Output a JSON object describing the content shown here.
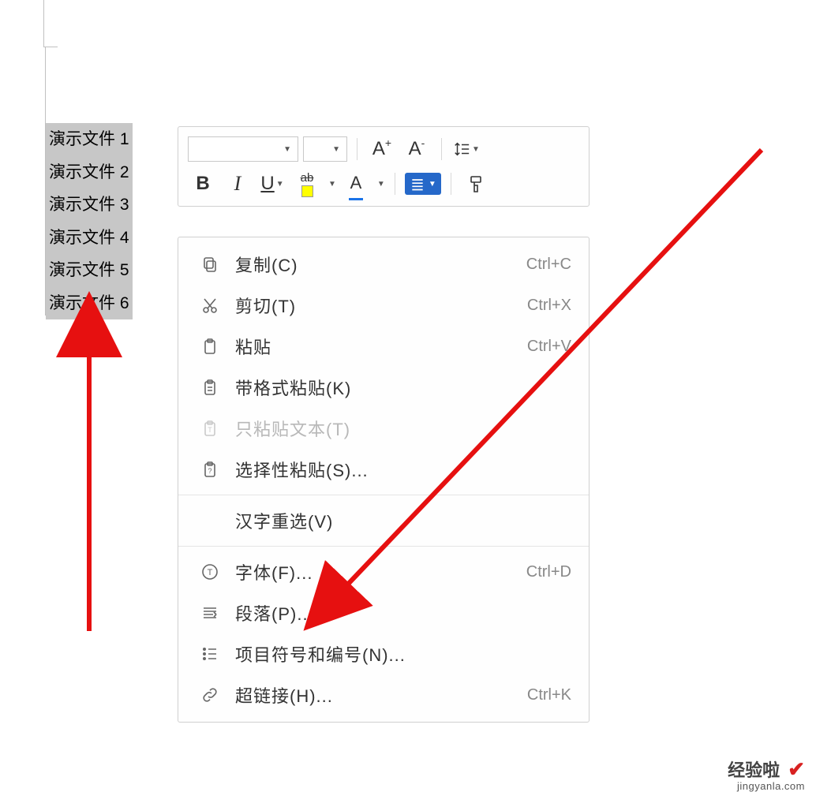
{
  "document": {
    "lines": [
      "演示文件 1",
      "演示文件 2",
      "演示文件 3",
      "演示文件 4",
      "演示文件 5",
      "演示文件 6"
    ]
  },
  "mini_toolbar": {
    "font_name": "",
    "font_size": "",
    "increase_font": "A⁺",
    "decrease_font": "A⁻",
    "bold": "B",
    "italic": "I",
    "underline": "U",
    "highlight_letter": "ab",
    "fontcolor_letter": "A"
  },
  "context_menu": {
    "items": [
      {
        "icon": "copy",
        "label": "复制(C)",
        "shortcut": "Ctrl+C",
        "disabled": false
      },
      {
        "icon": "cut",
        "label": "剪切(T)",
        "shortcut": "Ctrl+X",
        "disabled": false
      },
      {
        "icon": "paste",
        "label": "粘贴",
        "shortcut": "Ctrl+V",
        "disabled": false
      },
      {
        "icon": "paste-fmt",
        "label": "带格式粘贴(K)",
        "shortcut": "",
        "disabled": false
      },
      {
        "icon": "paste-text",
        "label": "只粘贴文本(T)",
        "shortcut": "",
        "disabled": true
      },
      {
        "icon": "paste-spec",
        "label": "选择性粘贴(S)...",
        "shortcut": "",
        "disabled": false
      },
      {
        "icon": "",
        "label": "汉字重选(V)",
        "shortcut": "",
        "disabled": false
      },
      {
        "icon": "font",
        "label": "字体(F)...",
        "shortcut": "Ctrl+D",
        "disabled": false
      },
      {
        "icon": "paragraph",
        "label": "段落(P)...",
        "shortcut": "",
        "disabled": false
      },
      {
        "icon": "bullets",
        "label": "项目符号和编号(N)...",
        "shortcut": "",
        "disabled": false
      },
      {
        "icon": "link",
        "label": "超链接(H)...",
        "shortcut": "Ctrl+K",
        "disabled": false
      }
    ]
  },
  "watermark": {
    "title": "经验啦",
    "url": "jingyanla.com"
  }
}
